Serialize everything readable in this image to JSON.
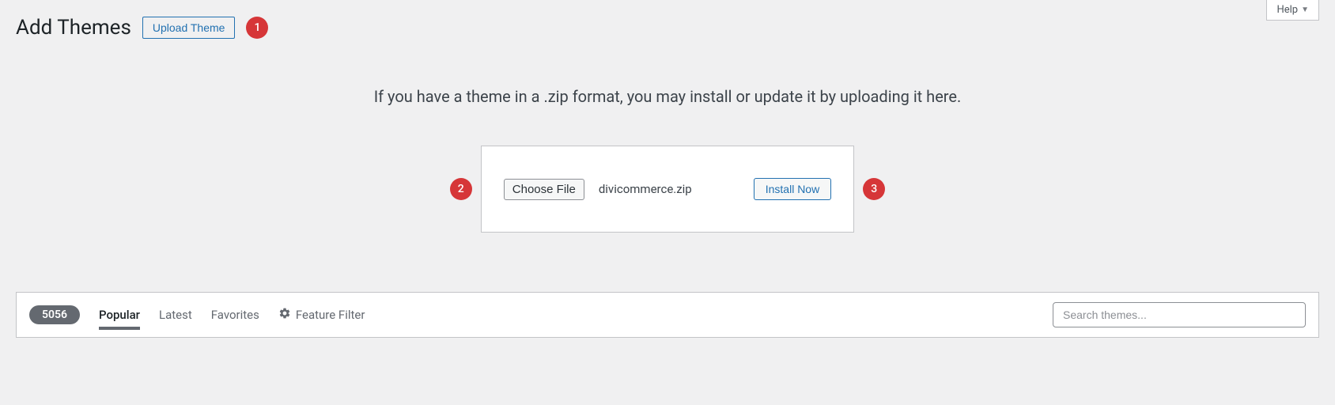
{
  "help": {
    "label": "Help"
  },
  "header": {
    "title": "Add Themes",
    "upload_button": "Upload Theme"
  },
  "badges": {
    "b1": "1",
    "b2": "2",
    "b3": "3"
  },
  "upload": {
    "help_text": "If you have a theme in a .zip format, you may install or update it by uploading it here.",
    "choose_file_label": "Choose File",
    "filename": "divicommerce.zip",
    "install_label": "Install Now"
  },
  "filter": {
    "count": "5056",
    "tabs": {
      "popular": "Popular",
      "latest": "Latest",
      "favorites": "Favorites",
      "feature_filter": "Feature Filter"
    },
    "search_placeholder": "Search themes..."
  }
}
